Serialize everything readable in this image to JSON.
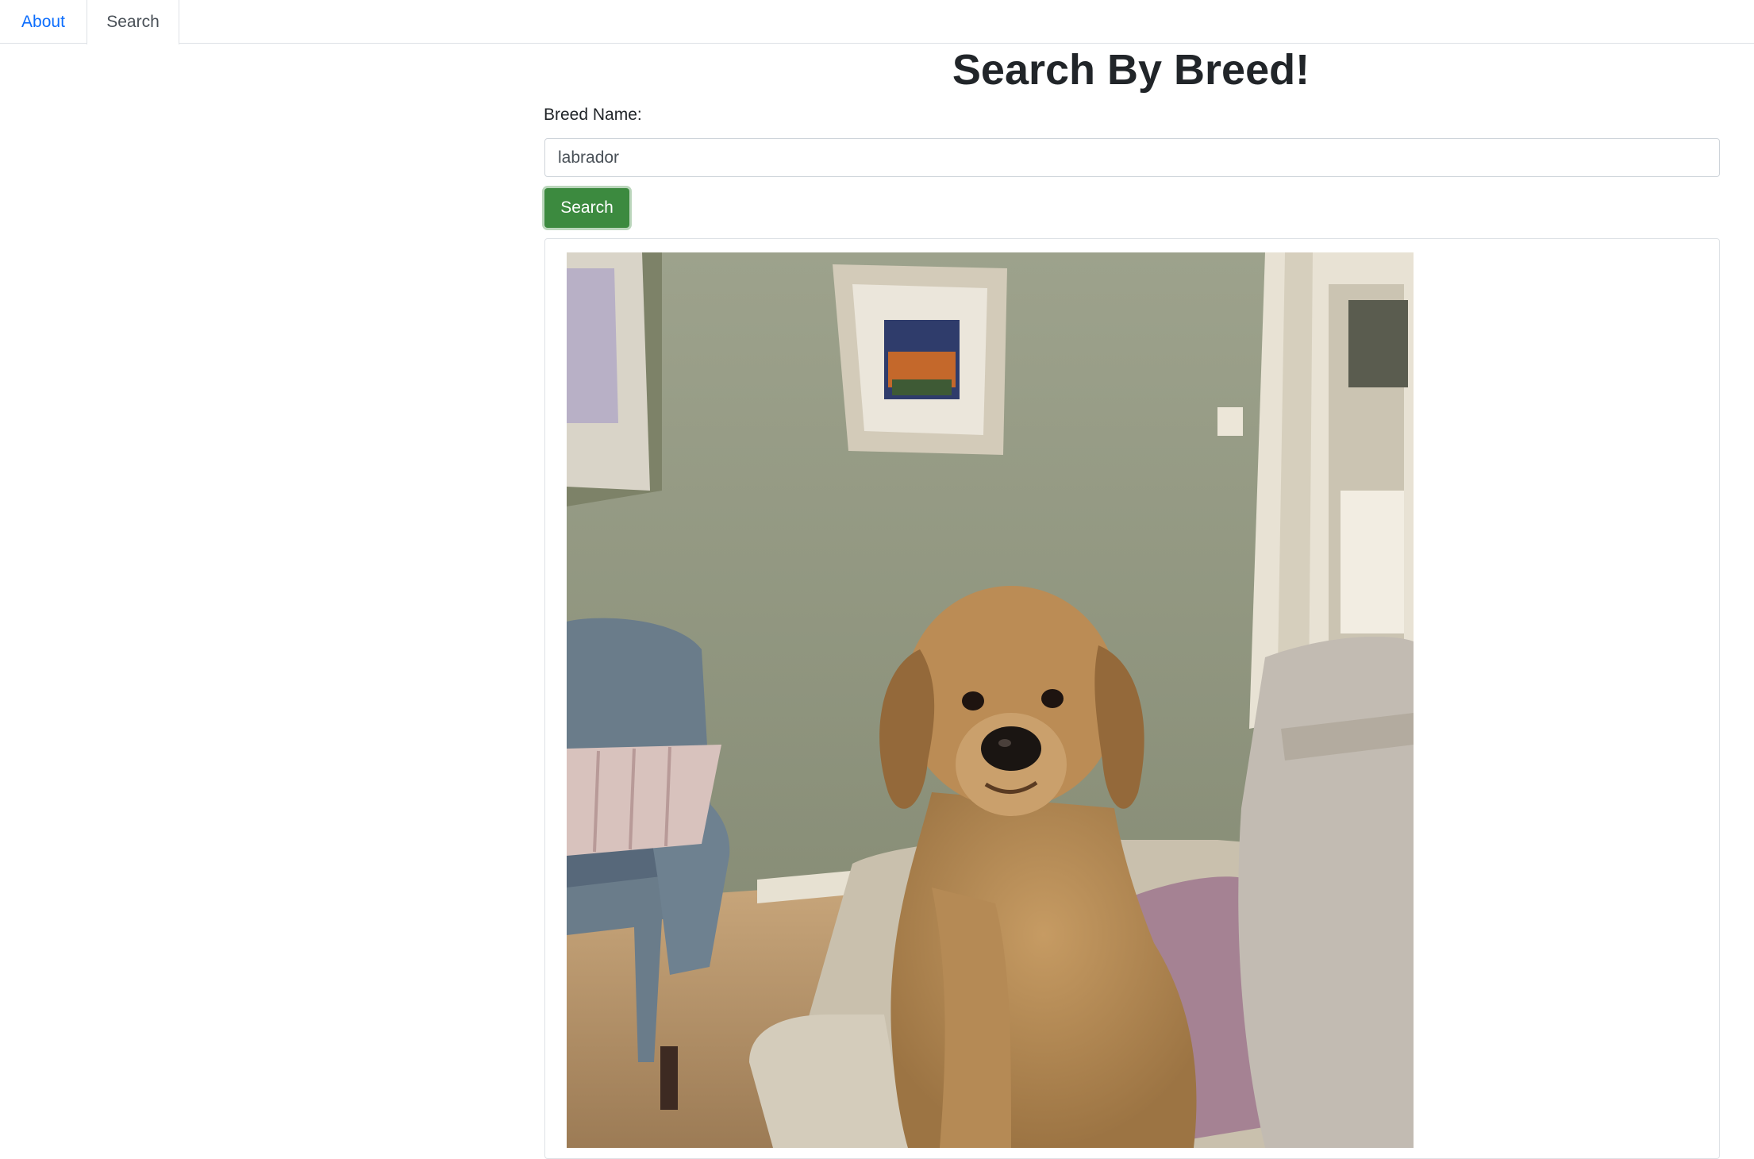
{
  "tabs": [
    {
      "label": "About",
      "active": false
    },
    {
      "label": "Search",
      "active": true
    }
  ],
  "page": {
    "title": "Search By Breed!"
  },
  "form": {
    "label": "Breed Name:",
    "input_value": "labrador",
    "button_label": "Search",
    "button_color": "#3c8a3f"
  },
  "result": {
    "image_subject": "yellow labrador sitting on a sofa in a living room"
  },
  "colors": {
    "link": "#0d6efd",
    "border": "#dee2e6"
  }
}
